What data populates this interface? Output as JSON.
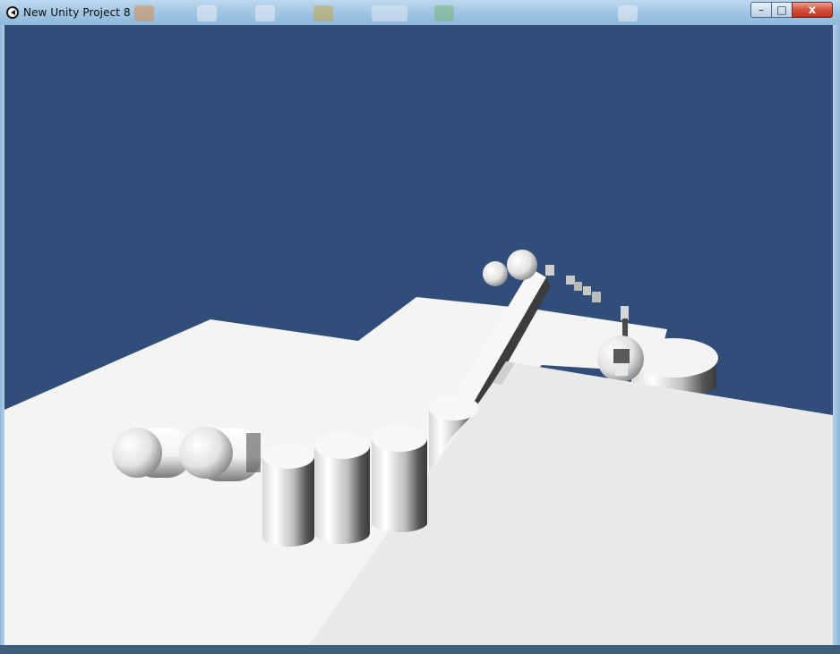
{
  "window": {
    "title": "New Unity Project 8",
    "icon": "unity-icon",
    "controls": {
      "minimize_icon": "minimize-icon",
      "maximize_icon": "maximize-icon",
      "close_icon": "close-icon",
      "close_glyph": "x"
    }
  },
  "scene": {
    "sky_color": "#314d79",
    "ground_color": "#f4f4f4",
    "ramp_color": "#e8e8e8",
    "shadow_color": "#3a3a3a"
  }
}
